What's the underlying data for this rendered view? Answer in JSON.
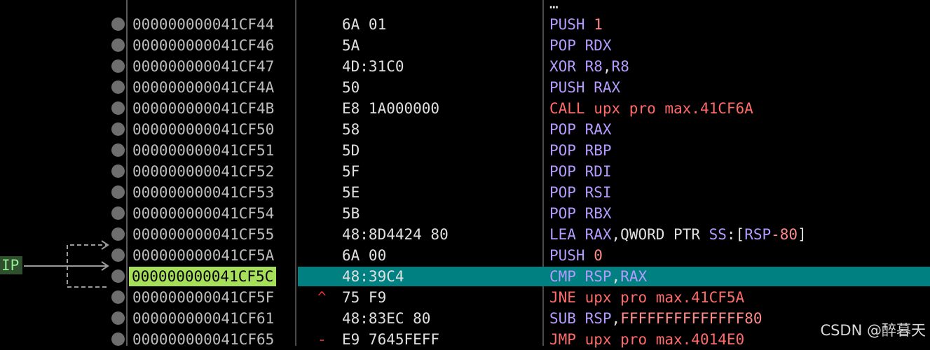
{
  "ip_label": "IP",
  "watermark": "CSDN @醉暮天",
  "rows": [
    {
      "addr": "",
      "bytes": "",
      "mark": "",
      "mnemonic": "",
      "operands": [
        {
          "t": "…",
          "c": "op"
        }
      ],
      "partial": true
    },
    {
      "addr": "000000000041CF44",
      "bytes": "6A 01",
      "mark": "",
      "mnemonic": "PUSH",
      "mc": "m",
      "operands": [
        {
          "t": "1",
          "c": "num"
        }
      ]
    },
    {
      "addr": "000000000041CF46",
      "bytes": "5A",
      "mark": "",
      "mnemonic": "POP",
      "mc": "m",
      "operands": [
        {
          "t": "RDX",
          "c": "reg"
        }
      ]
    },
    {
      "addr": "000000000041CF47",
      "bytes": "4D:31C0",
      "mark": "",
      "mnemonic": "XOR",
      "mc": "m",
      "operands": [
        {
          "t": "R8",
          "c": "reg"
        },
        {
          "t": ",",
          "c": "op"
        },
        {
          "t": "R8",
          "c": "reg"
        }
      ]
    },
    {
      "addr": "000000000041CF4A",
      "bytes": "50",
      "mark": "",
      "mnemonic": "PUSH",
      "mc": "m",
      "operands": [
        {
          "t": "RAX",
          "c": "reg"
        }
      ]
    },
    {
      "addr": "000000000041CF4B",
      "bytes": "E8 1A000000",
      "mark": "",
      "mnemonic": "CALL",
      "mc": "m-red",
      "operands": [
        {
          "t": "upx pro max.41CF6A",
          "c": "m-red"
        }
      ]
    },
    {
      "addr": "000000000041CF50",
      "bytes": "58",
      "mark": "",
      "mnemonic": "POP",
      "mc": "m",
      "operands": [
        {
          "t": "RAX",
          "c": "reg"
        }
      ]
    },
    {
      "addr": "000000000041CF51",
      "bytes": "5D",
      "mark": "",
      "mnemonic": "POP",
      "mc": "m",
      "operands": [
        {
          "t": "RBP",
          "c": "reg"
        }
      ]
    },
    {
      "addr": "000000000041CF52",
      "bytes": "5F",
      "mark": "",
      "mnemonic": "POP",
      "mc": "m",
      "operands": [
        {
          "t": "RDI",
          "c": "reg"
        }
      ]
    },
    {
      "addr": "000000000041CF53",
      "bytes": "5E",
      "mark": "",
      "mnemonic": "POP",
      "mc": "m",
      "operands": [
        {
          "t": "RSI",
          "c": "reg"
        }
      ]
    },
    {
      "addr": "000000000041CF54",
      "bytes": "5B",
      "mark": "",
      "mnemonic": "POP",
      "mc": "m",
      "operands": [
        {
          "t": "RBX",
          "c": "reg"
        }
      ]
    },
    {
      "addr": "000000000041CF55",
      "bytes": "48:8D4424 80",
      "mark": "",
      "mnemonic": "LEA",
      "mc": "m",
      "operands": [
        {
          "t": "RAX",
          "c": "reg"
        },
        {
          "t": ",QWORD PTR ",
          "c": "op"
        },
        {
          "t": "SS",
          "c": "reg"
        },
        {
          "t": ":[",
          "c": "op"
        },
        {
          "t": "RSP",
          "c": "reg"
        },
        {
          "t": "-80",
          "c": "num"
        },
        {
          "t": "]",
          "c": "op"
        }
      ]
    },
    {
      "addr": "000000000041CF5A",
      "bytes": "6A 00",
      "mark": "",
      "mnemonic": "PUSH",
      "mc": "m",
      "operands": [
        {
          "t": "0",
          "c": "num"
        }
      ]
    },
    {
      "addr": "000000000041CF5C",
      "bytes": "48:39C4",
      "mark": "",
      "mnemonic": "CMP",
      "mc": "m",
      "operands": [
        {
          "t": "RSP",
          "c": "reg"
        },
        {
          "t": ",",
          "c": "op"
        },
        {
          "t": "RAX",
          "c": "reg"
        }
      ],
      "selected": true
    },
    {
      "addr": "000000000041CF5F",
      "bytes": "75 F9",
      "mark": "^",
      "mnemonic": "JNE",
      "mc": "m-red",
      "operands": [
        {
          "t": "upx pro max.41CF5A",
          "c": "m-red"
        }
      ]
    },
    {
      "addr": "000000000041CF61",
      "bytes": "48:83EC 80",
      "mark": "",
      "mnemonic": "SUB",
      "mc": "m",
      "operands": [
        {
          "t": "RSP",
          "c": "reg"
        },
        {
          "t": ",",
          "c": "op"
        },
        {
          "t": "FFFFFFFFFFFFFF80",
          "c": "num"
        }
      ]
    },
    {
      "addr": "000000000041CF65",
      "bytes": "E9 7645FEFF",
      "mark": "-",
      "mnemonic": "JMP",
      "mc": "m-red",
      "operands": [
        {
          "t": "upx pro max.4014E0",
          "c": "m-red"
        }
      ]
    }
  ]
}
